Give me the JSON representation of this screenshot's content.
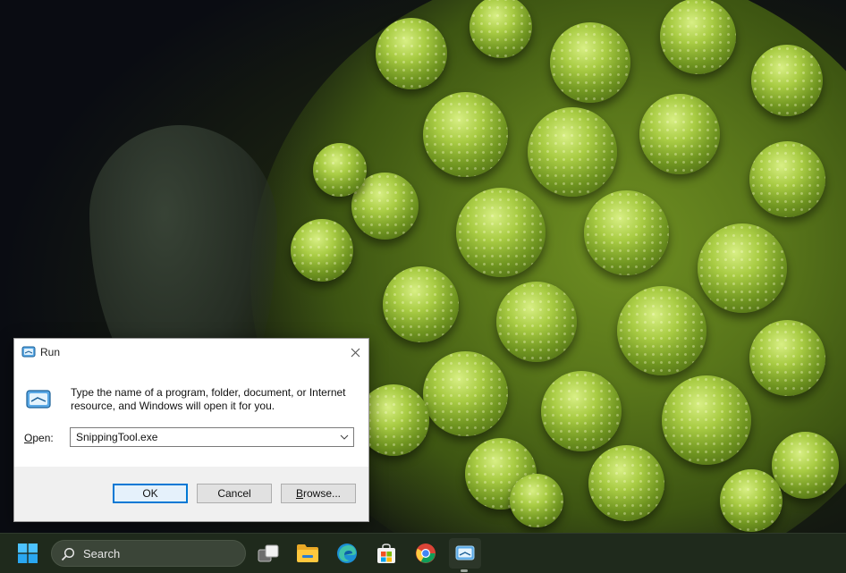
{
  "run_dialog": {
    "title": "Run",
    "description": "Type the name of a program, folder, document, or Internet resource, and Windows will open it for you.",
    "open_label_accel": "O",
    "open_label_rest": "pen:",
    "open_value": "SnippingTool.exe",
    "buttons": {
      "ok": "OK",
      "cancel": "Cancel",
      "browse_accel": "B",
      "browse_rest": "rowse..."
    },
    "icons": {
      "title": "run-icon",
      "body": "run-icon",
      "close": "close-icon",
      "dropdown": "chevron-down-icon"
    }
  },
  "taskbar": {
    "search_label": "Search",
    "apps": [
      {
        "name": "start",
        "icon": "windows-logo-icon"
      },
      {
        "name": "task-view",
        "icon": "task-view-icon"
      },
      {
        "name": "file-explorer",
        "icon": "folder-icon"
      },
      {
        "name": "edge",
        "icon": "edge-icon"
      },
      {
        "name": "microsoft-store",
        "icon": "store-icon"
      },
      {
        "name": "chrome",
        "icon": "chrome-icon"
      },
      {
        "name": "run",
        "icon": "run-icon",
        "active": true
      }
    ]
  },
  "colors": {
    "accent": "#0078d4",
    "taskbar": "#1f2a1c",
    "dialog_bg": "#f0f0f0"
  }
}
